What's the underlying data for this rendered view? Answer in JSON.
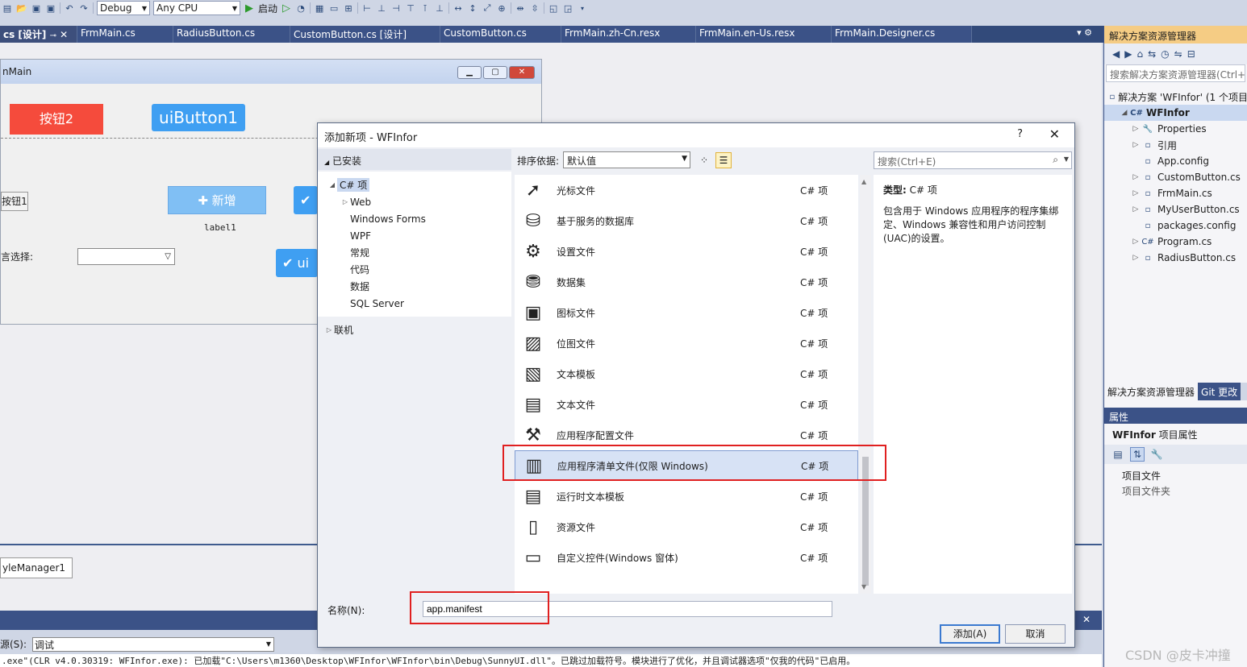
{
  "toolbar": {
    "config": "Debug",
    "platform": "Any CPU",
    "start": "启动"
  },
  "doc_tabs": [
    "cs [设计]",
    "FrmMain.cs",
    "RadiusButton.cs",
    "CustomButton.cs [设计]",
    "CustomButton.cs",
    "FrmMain.zh-Cn.resx",
    "FrmMain.en-Us.resx",
    "FrmMain.Designer.cs"
  ],
  "designer": {
    "form_title": "nMain",
    "btn_red": "按钮2",
    "btn_blue": "uiButton1",
    "btn_add": "新增",
    "label1": "label1",
    "btn_gray": "按钮1",
    "lang_label": "言选择:",
    "btn_ui": "ui",
    "tray_item": "yleManager1"
  },
  "output": {
    "source_label": "源(S):",
    "source_value": "调试",
    "line": ".exe\"(CLR v4.0.30319: WFInfor.exe): 已加载\"C:\\Users\\m1360\\Desktop\\WFInfor\\WFInfor\\bin\\Debug\\SunnyUI.dll\"。已跳过加载符号。模块进行了优化，并且调试器选项\"仅我的代码\"已启用。"
  },
  "solution": {
    "header": "解决方案资源管理器",
    "search_placeholder": "搜索解决方案资源管理器(Ctrl+;)",
    "tree": [
      {
        "label": "解决方案 'WFInfor' (1 个项目",
        "icon": "solution-icon",
        "indent": 0,
        "arrow": ""
      },
      {
        "label": "WFInfor",
        "icon": "csharp-project-icon",
        "indent": 1,
        "arrow": "◢",
        "selected": true
      },
      {
        "label": "Properties",
        "icon": "wrench-icon",
        "indent": 2,
        "arrow": "▷"
      },
      {
        "label": "引用",
        "icon": "references-icon",
        "indent": 2,
        "arrow": "▷"
      },
      {
        "label": "App.config",
        "icon": "config-file-icon",
        "indent": 2,
        "arrow": ""
      },
      {
        "label": "CustomButton.cs",
        "icon": "cs-file-icon",
        "indent": 2,
        "arrow": "▷"
      },
      {
        "label": "FrmMain.cs",
        "icon": "form-icon",
        "indent": 2,
        "arrow": "▷"
      },
      {
        "label": "MyUserButton.cs",
        "icon": "cs-file-icon",
        "indent": 2,
        "arrow": "▷"
      },
      {
        "label": "packages.config",
        "icon": "config-file-icon",
        "indent": 2,
        "arrow": ""
      },
      {
        "label": "Program.cs",
        "icon": "csharp-file-icon",
        "indent": 2,
        "arrow": "▷"
      },
      {
        "label": "RadiusButton.cs",
        "icon": "cs-file-icon",
        "indent": 2,
        "arrow": "▷"
      }
    ],
    "tab_active": "解决方案资源管理器",
    "tab_other": "Git 更改"
  },
  "properties": {
    "header": "属性",
    "title_bold": "WFInfor",
    "title_rest": " 项目属性",
    "rows": [
      "项目文件",
      "项目文件夹"
    ]
  },
  "dialog": {
    "title": "添加新项 - WFInfor",
    "help": "?",
    "close": "✕",
    "installed": "已安装",
    "tree": [
      {
        "label": "C# 项",
        "arrow": "◢",
        "indent": 1,
        "selected": true
      },
      {
        "label": "Web",
        "arrow": "▷",
        "indent": 2
      },
      {
        "label": "Windows Forms",
        "arrow": "",
        "indent": 2
      },
      {
        "label": "WPF",
        "arrow": "",
        "indent": 2
      },
      {
        "label": "常规",
        "arrow": "",
        "indent": 2
      },
      {
        "label": "代码",
        "arrow": "",
        "indent": 2
      },
      {
        "label": "数据",
        "arrow": "",
        "indent": 2
      },
      {
        "label": "SQL Server",
        "arrow": "",
        "indent": 2
      }
    ],
    "online": "联机",
    "sort_label": "排序依据:",
    "sort_value": "默认值",
    "search_placeholder": "搜索(Ctrl+E)",
    "items": [
      {
        "name": "光标文件",
        "type": "C# 项",
        "icon": "cursor-file-icon"
      },
      {
        "name": "基于服务的数据库",
        "type": "C# 项",
        "icon": "database-icon"
      },
      {
        "name": "设置文件",
        "type": "C# 项",
        "icon": "settings-gear-icon"
      },
      {
        "name": "数据集",
        "type": "C# 项",
        "icon": "dataset-icon"
      },
      {
        "name": "图标文件",
        "type": "C# 项",
        "icon": "icon-file-icon"
      },
      {
        "name": "位图文件",
        "type": "C# 项",
        "icon": "bitmap-file-icon"
      },
      {
        "name": "文本模板",
        "type": "C# 项",
        "icon": "text-template-icon"
      },
      {
        "name": "文本文件",
        "type": "C# 项",
        "icon": "text-file-icon"
      },
      {
        "name": "应用程序配置文件",
        "type": "C# 项",
        "icon": "app-config-icon"
      },
      {
        "name": "应用程序清单文件(仅限 Windows)",
        "type": "C# 项",
        "icon": "manifest-icon",
        "selected": true
      },
      {
        "name": "运行时文本模板",
        "type": "C# 项",
        "icon": "runtime-template-icon"
      },
      {
        "name": "资源文件",
        "type": "C# 项",
        "icon": "resource-file-icon"
      },
      {
        "name": "自定义控件(Windows 窗体)",
        "type": "C# 项",
        "icon": "custom-control-icon"
      }
    ],
    "desc_type_label": "类型:",
    "desc_type_value": "C# 项",
    "desc_text": "包含用于 Windows 应用程序的程序集绑定、Windows 兼容性和用户访问控制(UAC)的设置。",
    "name_label": "名称(N):",
    "name_value": "app.manifest",
    "add_button": "添加(A)",
    "cancel_button": "取消"
  },
  "watermark": "CSDN @皮卡冲撞"
}
